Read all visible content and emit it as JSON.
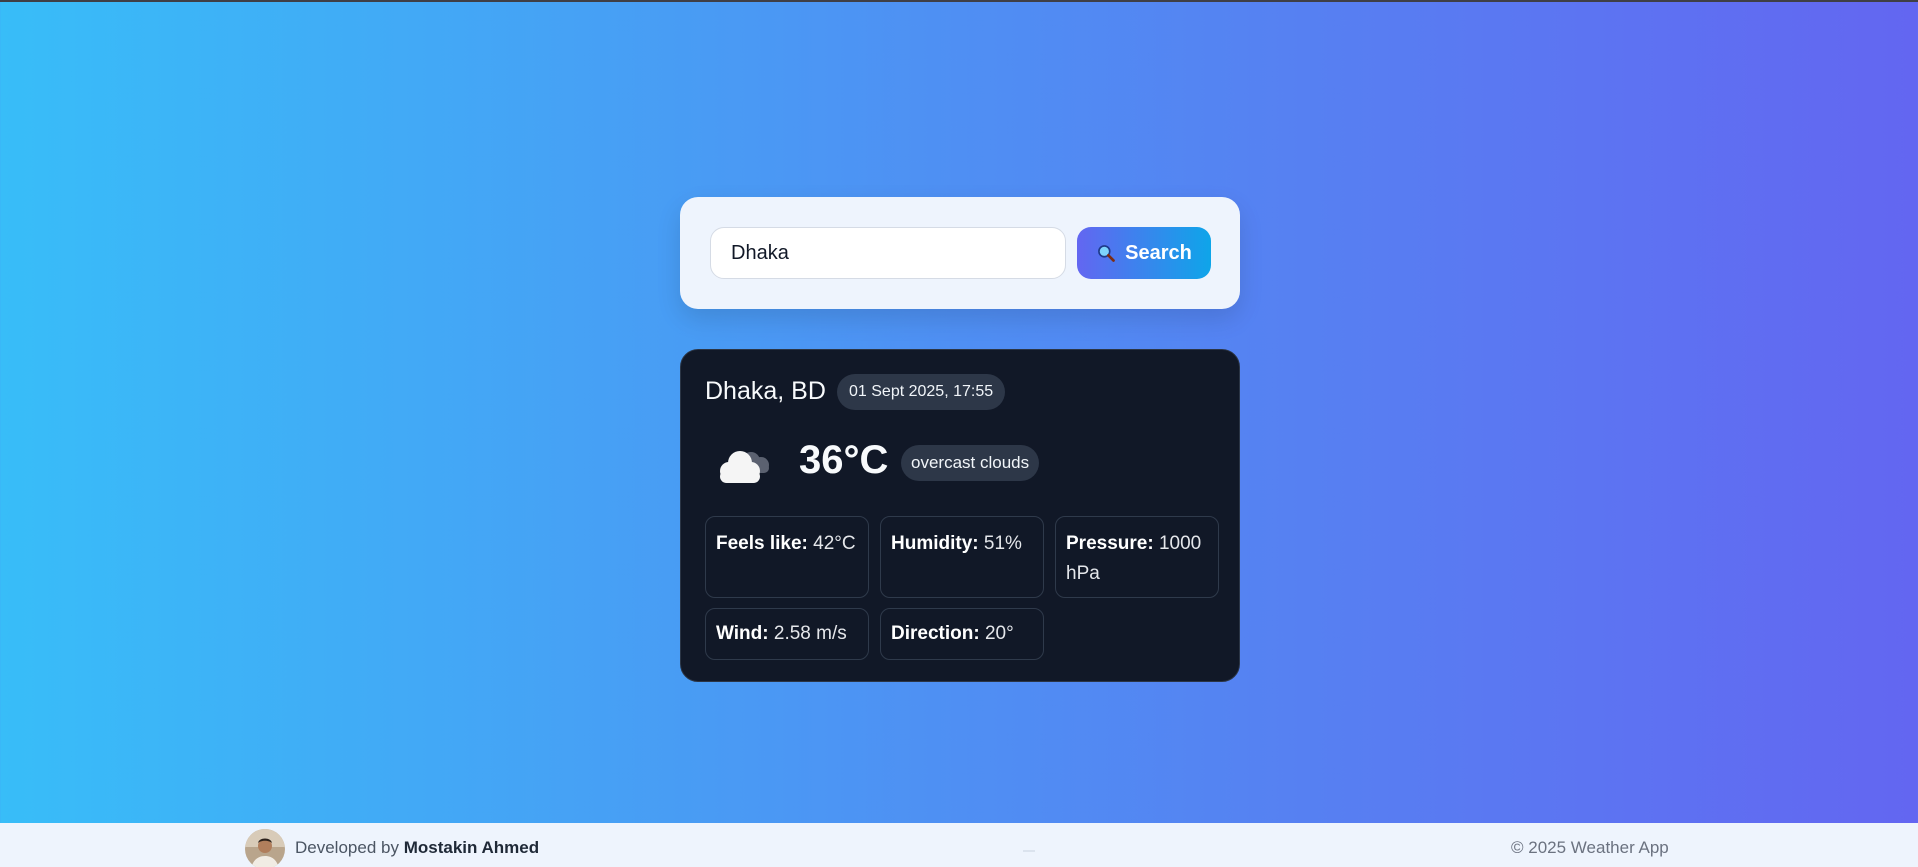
{
  "search": {
    "value": "Dhaka",
    "button_label": "Search",
    "button_icon": "magnifying-glass-icon"
  },
  "weather": {
    "city": "Dhaka, BD",
    "datetime": "01 Sept 2025, 17:55",
    "icon": "overcast-cloud-icon",
    "temperature": "36°C",
    "description": "overcast clouds",
    "stats": [
      {
        "label": "Feels like:",
        "value": "42°C"
      },
      {
        "label": "Humidity:",
        "value": "51%"
      },
      {
        "label": "Pressure:",
        "value": "1000 hPa"
      },
      {
        "label": "Wind:",
        "value": "2.58 m/s"
      },
      {
        "label": "Direction:",
        "value": "20°"
      }
    ]
  },
  "footer": {
    "developed_by": "Developed by",
    "developer_name": "Mostakin Ahmed",
    "copyright": "© 2025 Weather App"
  },
  "colors": {
    "background_gradient": [
      "#38bdf8",
      "#6366f1"
    ],
    "card_dark": "#111827",
    "button_gradient": [
      "#6366f1",
      "#0ea5e9"
    ]
  }
}
